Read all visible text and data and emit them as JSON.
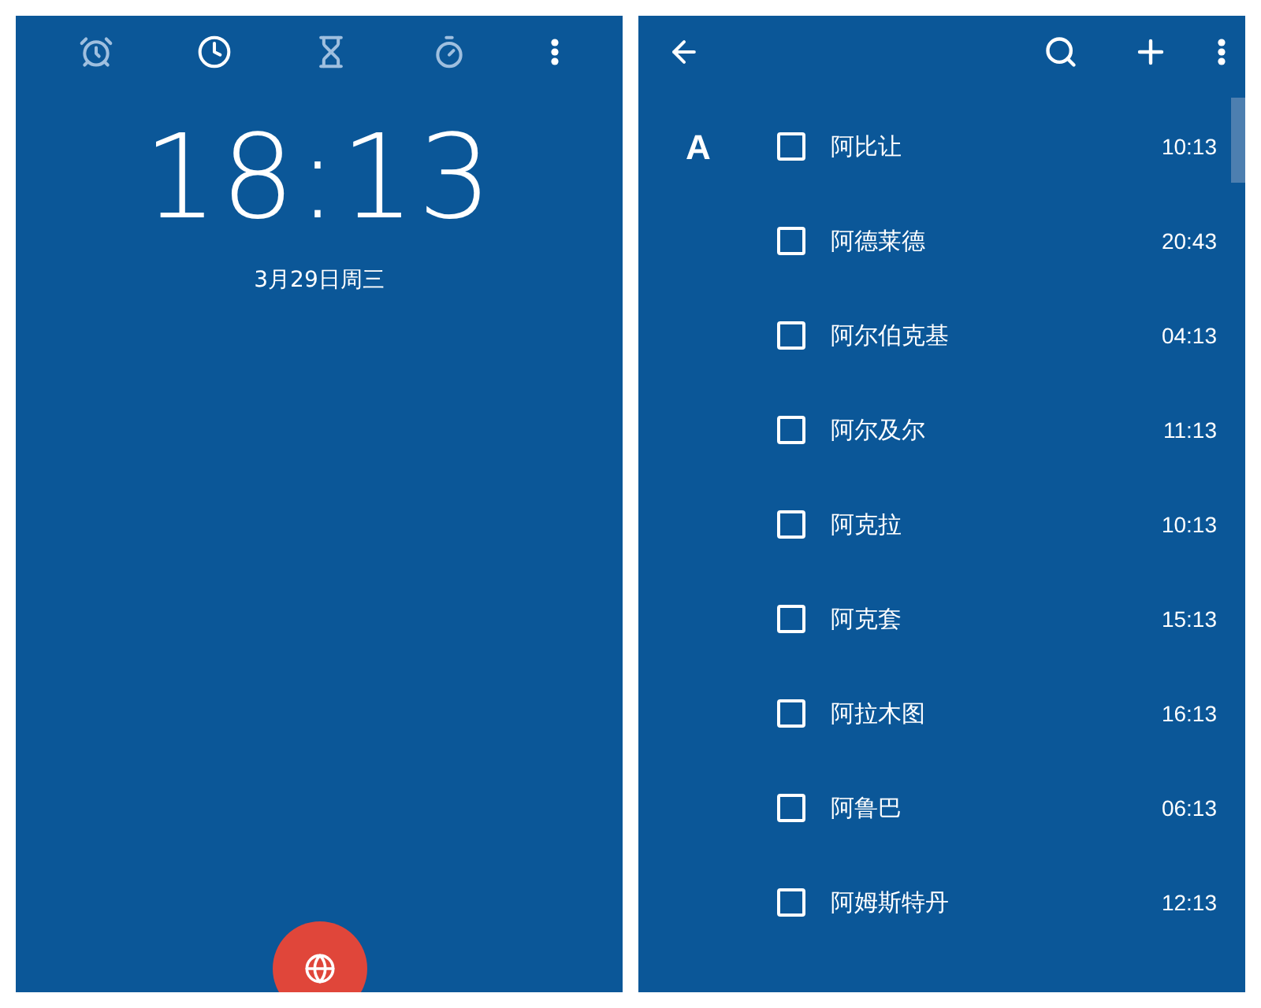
{
  "clock_screen": {
    "tabs": [
      {
        "kind": "alarm",
        "selected": false
      },
      {
        "kind": "clock",
        "selected": true
      },
      {
        "kind": "timer",
        "selected": false
      },
      {
        "kind": "stopwatch",
        "selected": false
      }
    ],
    "time": "18:13",
    "date": "3月29日周三"
  },
  "cities_screen": {
    "section_letter": "A",
    "cities": [
      {
        "name": "阿比让",
        "time": "10:13",
        "checked": false
      },
      {
        "name": "阿德莱德",
        "time": "20:43",
        "checked": false
      },
      {
        "name": "阿尔伯克基",
        "time": "04:13",
        "checked": false
      },
      {
        "name": "阿尔及尔",
        "time": "11:13",
        "checked": false
      },
      {
        "name": "阿克拉",
        "time": "10:13",
        "checked": false
      },
      {
        "name": "阿克套",
        "time": "15:13",
        "checked": false
      },
      {
        "name": "阿拉木图",
        "time": "16:13",
        "checked": false
      },
      {
        "name": "阿鲁巴",
        "time": "06:13",
        "checked": false
      },
      {
        "name": "阿姆斯特丹",
        "time": "12:13",
        "checked": false
      }
    ]
  }
}
